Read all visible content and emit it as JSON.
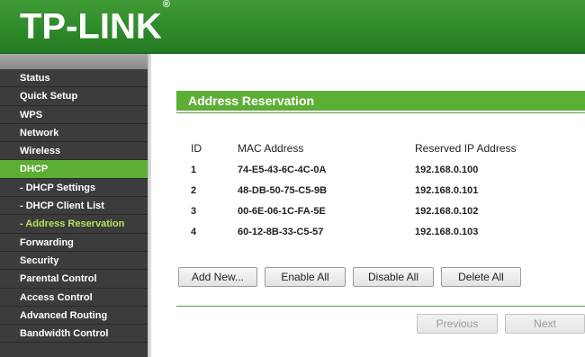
{
  "brand": {
    "logo_text": "TP-LINK",
    "trademark": "®"
  },
  "sidebar": {
    "items": [
      {
        "label": "Status"
      },
      {
        "label": "Quick Setup"
      },
      {
        "label": "WPS"
      },
      {
        "label": "Network"
      },
      {
        "label": "Wireless"
      },
      {
        "label": "DHCP"
      },
      {
        "label": "- DHCP Settings"
      },
      {
        "label": "- DHCP Client List"
      },
      {
        "label": "- Address Reservation"
      },
      {
        "label": "Forwarding"
      },
      {
        "label": "Security"
      },
      {
        "label": "Parental Control"
      },
      {
        "label": "Access Control"
      },
      {
        "label": "Advanced Routing"
      },
      {
        "label": "Bandwidth Control"
      }
    ]
  },
  "main": {
    "title": "Address Reservation",
    "table": {
      "headers": {
        "id": "ID",
        "mac": "MAC Address",
        "ip": "Reserved IP Address"
      },
      "rows": [
        {
          "id": "1",
          "mac": "74-E5-43-6C-4C-0A",
          "ip": "192.168.0.100"
        },
        {
          "id": "2",
          "mac": "48-DB-50-75-C5-9B",
          "ip": "192.168.0.101"
        },
        {
          "id": "3",
          "mac": "00-6E-06-1C-FA-5E",
          "ip": "192.168.0.102"
        },
        {
          "id": "4",
          "mac": "60-12-8B-33-C5-57",
          "ip": "192.168.0.103"
        }
      ]
    },
    "buttons": {
      "add_new": "Add New...",
      "enable_all": "Enable All",
      "disable_all": "Disable All",
      "delete_all": "Delete All",
      "previous": "Previous",
      "next": "Next"
    }
  },
  "colors": {
    "brand_green": "#2f8a2a",
    "accent_green": "#5dae35",
    "current_text": "#b5e35c",
    "sidebar_bg": "#3c3c3c"
  }
}
